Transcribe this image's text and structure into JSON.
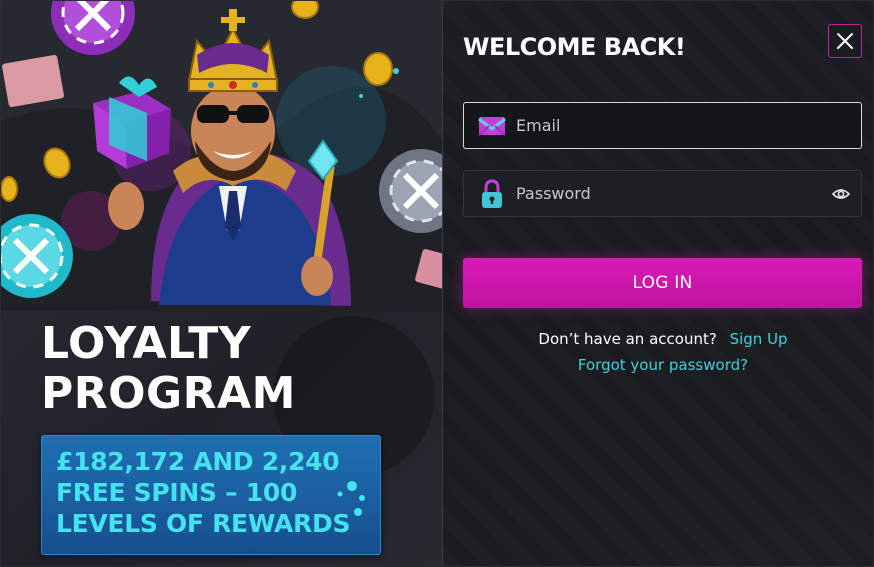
{
  "promo": {
    "title_line1": "LOYALTY",
    "title_line2": "PROGRAM",
    "banner_line1": "£182,172 AND 2,240",
    "banner_line2": "FREE SPINS – 100",
    "banner_line3": "LEVELS OF REWARDS"
  },
  "form": {
    "heading": "WELCOME BACK!",
    "email_placeholder": "Email",
    "password_placeholder": "Password",
    "login_label": "LOG IN",
    "no_account_text": "Don’t have an account?",
    "signup_link": "Sign Up",
    "forgot_link": "Forgot your password?"
  },
  "icons": {
    "close": "close-icon",
    "email": "envelope-icon",
    "password": "padlock-icon",
    "reveal": "eye-icon"
  },
  "colors": {
    "accent_magenta": "#d81ab6",
    "link_cyan": "#3fd0e0",
    "banner_blue": "#1a5ea0",
    "banner_text": "#45e3f0"
  }
}
